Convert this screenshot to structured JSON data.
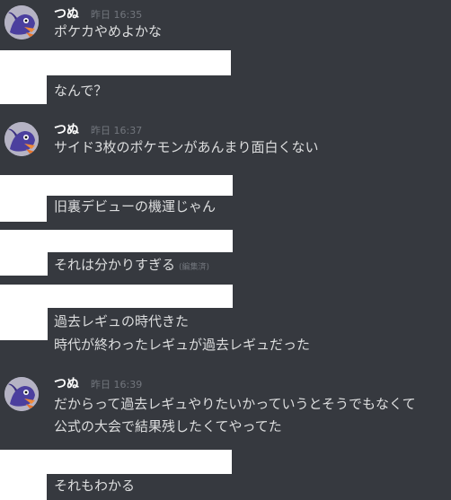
{
  "colors": {
    "background": "#36393f",
    "text": "#dcddde",
    "username": "#ffffff",
    "timestamp": "#72767d",
    "redaction": "#ffffff"
  },
  "groups": [
    {
      "username": "つぬ",
      "timestamp": "昨日 16:35",
      "avatar_icon": "bird-pokemon-avatar",
      "messages": [
        "ポケカやめよかな"
      ]
    },
    {
      "messages": [
        "なんで？"
      ]
    },
    {
      "username": "つぬ",
      "timestamp": "昨日 16:37",
      "avatar_icon": "bird-pokemon-avatar",
      "messages": [
        "サイド3枚のポケモンがあんまり面白くない"
      ]
    },
    {
      "messages": [
        "旧裏デビューの機運じゃん"
      ]
    },
    {
      "messages": [
        "それは分かりすぎる"
      ],
      "edited": "(編集済)"
    },
    {
      "messages": [
        "過去レギュの時代きた",
        "時代が終わったレギュが過去レギュだった"
      ]
    },
    {
      "username": "つぬ",
      "timestamp": "昨日 16:39",
      "avatar_icon": "bird-pokemon-avatar",
      "messages": [
        "だからって過去レギュやりたいかっていうとそうでもなくて",
        "公式の大会で結果残したくてやってた"
      ]
    },
    {
      "messages": [
        "それもわかる"
      ]
    }
  ]
}
